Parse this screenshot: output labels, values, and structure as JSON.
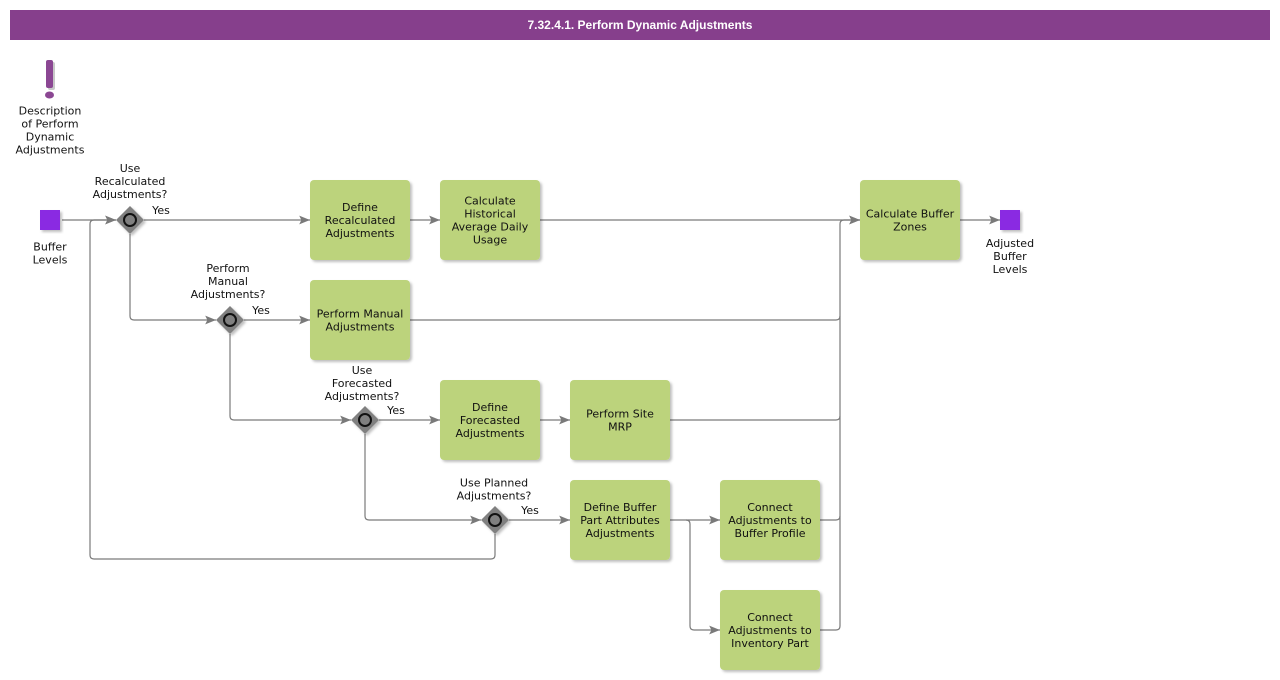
{
  "title": "7.32.4.1. Perform Dynamic Adjustments",
  "colors": {
    "title_bar": "#863f8c",
    "task_fill": "#bcd37c",
    "event_fill": "#8a2be2",
    "gateway_fill": "#808080",
    "annotation_icon": "#8b4793",
    "edge": "#7a7a7a"
  },
  "annotation": {
    "icon": "exclamation-icon",
    "label": [
      "Description",
      "of Perform",
      "Dynamic",
      "Adjustments"
    ]
  },
  "events": [
    {
      "id": "start",
      "type": "start",
      "label": [
        "Buffer",
        "Levels"
      ]
    },
    {
      "id": "end",
      "type": "end",
      "label": [
        "Adjusted",
        "Buffer",
        "Levels"
      ]
    }
  ],
  "gateways": [
    {
      "id": "g1",
      "label": [
        "Use",
        "Recalculated",
        "Adjustments?"
      ],
      "yes_label": "Yes"
    },
    {
      "id": "g2",
      "label": [
        "Perform",
        "Manual",
        "Adjustments?"
      ],
      "yes_label": "Yes"
    },
    {
      "id": "g3",
      "label": [
        "Use",
        "Forecasted",
        "Adjustments?"
      ],
      "yes_label": "Yes"
    },
    {
      "id": "g4",
      "label": [
        "Use Planned",
        "Adjustments?"
      ],
      "yes_label": "Yes"
    }
  ],
  "tasks": [
    {
      "id": "t1",
      "label": [
        "Define",
        "Recalculated",
        "Adjustments"
      ]
    },
    {
      "id": "t2",
      "label": [
        "Calculate",
        "Historical",
        "Average Daily",
        "Usage"
      ]
    },
    {
      "id": "t3",
      "label": [
        "Calculate Buffer",
        "Zones"
      ]
    },
    {
      "id": "t4",
      "label": [
        "Perform Manual",
        "Adjustments"
      ]
    },
    {
      "id": "t5",
      "label": [
        "Define",
        "Forecasted",
        "Adjustments"
      ]
    },
    {
      "id": "t6",
      "label": [
        "Perform Site",
        "MRP"
      ]
    },
    {
      "id": "t7",
      "label": [
        "Define Buffer",
        "Part Attributes",
        "Adjustments"
      ]
    },
    {
      "id": "t8",
      "label": [
        "Connect",
        "Adjustments to",
        "Buffer Profile"
      ]
    },
    {
      "id": "t9",
      "label": [
        "Connect",
        "Adjustments to",
        "Inventory Part"
      ]
    }
  ],
  "flows": [
    {
      "from": "start",
      "to": "g1"
    },
    {
      "from": "g1",
      "to": "t1",
      "label": "Yes"
    },
    {
      "from": "g1",
      "to": "g2"
    },
    {
      "from": "t1",
      "to": "t2"
    },
    {
      "from": "t2",
      "to": "t3"
    },
    {
      "from": "g2",
      "to": "t4",
      "label": "Yes"
    },
    {
      "from": "g2",
      "to": "g3"
    },
    {
      "from": "t4",
      "to": "t3"
    },
    {
      "from": "g3",
      "to": "t5",
      "label": "Yes"
    },
    {
      "from": "g3",
      "to": "g4"
    },
    {
      "from": "t5",
      "to": "t6"
    },
    {
      "from": "t6",
      "to": "t3"
    },
    {
      "from": "g4",
      "to": "t7",
      "label": "Yes"
    },
    {
      "from": "g4",
      "to": "g1"
    },
    {
      "from": "t7",
      "to": "t8"
    },
    {
      "from": "t7",
      "to": "t9"
    },
    {
      "from": "t8",
      "to": "t3"
    },
    {
      "from": "t9",
      "to": "t3"
    },
    {
      "from": "t3",
      "to": "end"
    }
  ]
}
